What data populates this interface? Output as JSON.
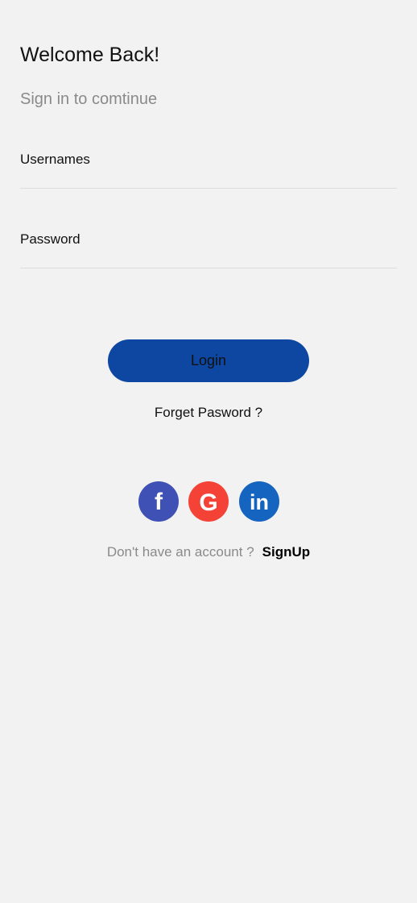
{
  "header": {
    "title": "Welcome Back!",
    "subtitle": "Sign in to comtinue"
  },
  "form": {
    "username_placeholder": "Usernames",
    "password_placeholder": "Password",
    "login_label": "Login",
    "forget_label": "Forget Pasword ?"
  },
  "social": {
    "facebook": {
      "icon": "facebook-icon",
      "glyph": "f",
      "color": "#3f51b5"
    },
    "google": {
      "icon": "google-icon",
      "glyph": "G",
      "color": "#f44336"
    },
    "linkedin": {
      "icon": "linkedin-icon",
      "glyph": "in",
      "color": "#1565c0"
    }
  },
  "footer": {
    "prompt": "Don't have an account ?",
    "signup_label": "SignUp"
  },
  "colors": {
    "background": "#f2f2f2",
    "primary": "#0d47a1",
    "muted_text": "#8a8a8a"
  }
}
